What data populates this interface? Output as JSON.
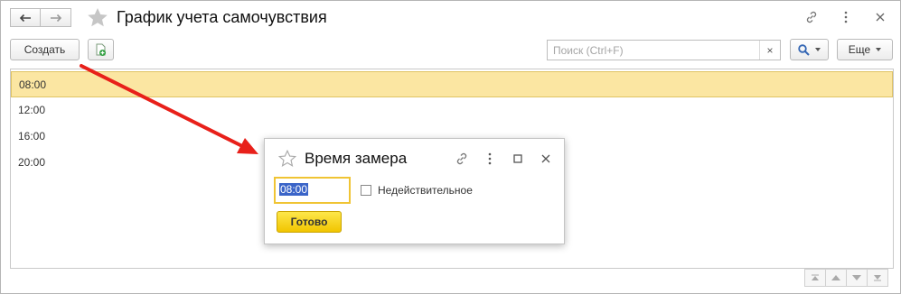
{
  "window": {
    "title": "График учета самочувствия",
    "back_icon": "arrow-left-icon",
    "forward_icon": "arrow-right-icon",
    "favorite_icon": "star-icon",
    "link_icon": "link-icon",
    "menu_icon": "more-vertical-icon",
    "close_icon": "close-icon"
  },
  "toolbar": {
    "create_label": "Создать",
    "add_icon": "add-document-icon",
    "search_placeholder": "Поиск (Ctrl+F)",
    "search_clear": "×",
    "search_icon": "search-icon",
    "more_label": "Еще"
  },
  "list": {
    "rows": [
      {
        "time": "08:00",
        "selected": true
      },
      {
        "time": "12:00",
        "selected": false
      },
      {
        "time": "16:00",
        "selected": false
      },
      {
        "time": "20:00",
        "selected": false
      }
    ]
  },
  "scroll_buttons": [
    "scroll-top-icon",
    "scroll-up-icon",
    "scroll-down-icon",
    "scroll-bottom-icon"
  ],
  "dialog": {
    "title": "Время замера",
    "time_value": "08:00",
    "invalid_label": "Недействительное",
    "invalid_checked": false,
    "done_label": "Готово"
  },
  "colors": {
    "selected_row": "#fbe6a2",
    "accent_yellow": "#f1c500",
    "arrow_red": "#e8201a",
    "selection_blue": "#3a64c8"
  }
}
